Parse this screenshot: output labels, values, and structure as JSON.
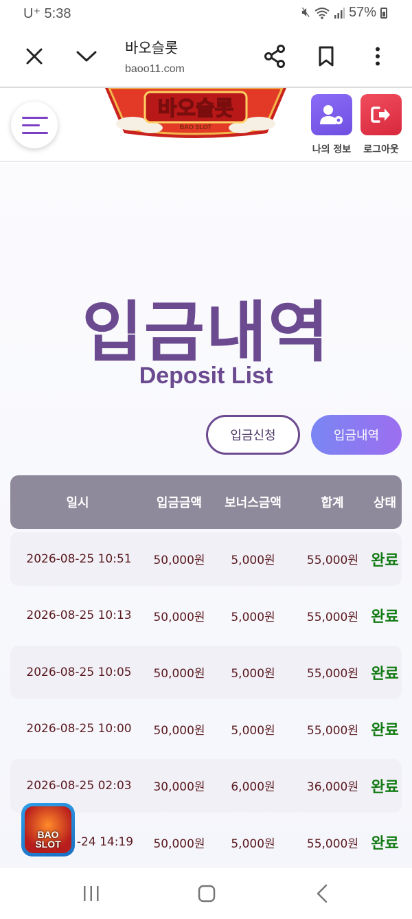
{
  "status_bar": {
    "carrier_time": "U⁺ 5:38",
    "battery": "57%"
  },
  "browser": {
    "title": "바오슬롯",
    "url": "baoo11.com",
    "icons": [
      "close-icon",
      "chevron-down-icon",
      "share-icon",
      "bookmark-icon",
      "more-vertical-icon"
    ]
  },
  "header": {
    "logo_text": "바오슬롯",
    "logo_sub": "BAO SLOT",
    "my_info_label": "나의 정보",
    "logout_label": "로그아웃",
    "colors": {
      "accent": "#7b3fc4",
      "my_info": "#7a5cf0",
      "logout": "#e63a4d"
    }
  },
  "page": {
    "title": "입금내역",
    "subtitle": "Deposit List",
    "tabs": [
      {
        "label": "입금신청",
        "active": false
      },
      {
        "label": "입금내역",
        "active": true
      }
    ]
  },
  "table": {
    "headers": [
      "일시",
      "입금금액",
      "보너스금액",
      "합계",
      "상태"
    ],
    "rows": [
      {
        "date": "2026-08-25 10:51",
        "amount": "50,000원",
        "bonus": "5,000원",
        "total": "55,000원",
        "status": "완료"
      },
      {
        "date": "2026-08-25 10:13",
        "amount": "50,000원",
        "bonus": "5,000원",
        "total": "55,000원",
        "status": "완료"
      },
      {
        "date": "2026-08-25 10:05",
        "amount": "50,000원",
        "bonus": "5,000원",
        "total": "55,000원",
        "status": "완료"
      },
      {
        "date": "2026-08-25 10:00",
        "amount": "50,000원",
        "bonus": "5,000원",
        "total": "55,000원",
        "status": "완료"
      },
      {
        "date": "2026-08-25 02:03",
        "amount": "30,000원",
        "bonus": "6,000원",
        "total": "36,000원",
        "status": "완료"
      },
      {
        "date": "-24 14:19",
        "amount": "50,000원",
        "bonus": "5,000원",
        "total": "55,000원",
        "status": "완료"
      }
    ]
  },
  "floating_badge": {
    "text": "BAO SLOT"
  },
  "nav": {
    "icons": [
      "recent-apps-icon",
      "home-icon",
      "back-icon"
    ]
  }
}
